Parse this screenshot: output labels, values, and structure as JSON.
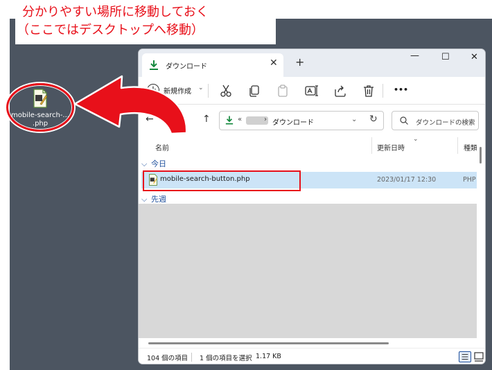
{
  "callout": {
    "line1": "分かりやすい場所に移動しておく",
    "line2": "（ここではデスクトップへ移動）"
  },
  "desktop_icon": {
    "label_line1": "mobile-search-...",
    "label_line2": ".php",
    "icon": "php-file-icon"
  },
  "window": {
    "tab_title": "ダウンロード",
    "tab_icon": "download-icon",
    "new_tab": "+",
    "controls": {
      "minimize": "—",
      "maximize": "☐",
      "close": "✕"
    },
    "toolbar": {
      "new_label": "新規作成",
      "icons": [
        "cut-icon",
        "copy-icon",
        "paste-icon",
        "rename-icon",
        "share-icon",
        "delete-icon",
        "more-icon"
      ],
      "more_label": "•••"
    },
    "address": {
      "prefix": "«",
      "separator": "›",
      "crumb": "ダウンロード"
    },
    "search_placeholder": "ダウンロードの検索",
    "columns": {
      "name": "名前",
      "modified": "更新日時",
      "type": "種類"
    },
    "groups": {
      "today": "今日",
      "last_week": "先週"
    },
    "file": {
      "name": "mobile-search-button.php",
      "modified": "2023/01/17 12:30",
      "type": "PHP"
    },
    "status": {
      "count": "104 個の項目",
      "selected": "1 個の項目を選択",
      "size": "1.17 KB"
    }
  },
  "colors": {
    "accent_red": "#e8101a",
    "selection": "#cce4f7",
    "desktop": "#4c5561",
    "download_green": "#15893e"
  }
}
